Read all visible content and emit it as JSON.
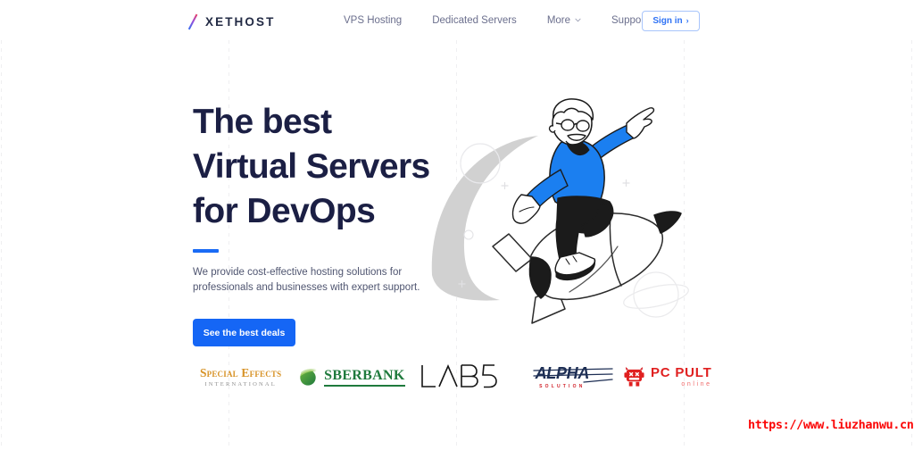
{
  "header": {
    "logo": {
      "mark": "slash-gradient",
      "text": "XETHOST"
    },
    "nav": [
      {
        "label": "VPS Hosting",
        "has_dropdown": false
      },
      {
        "label": "Dedicated Servers",
        "has_dropdown": false
      },
      {
        "label": "More",
        "has_dropdown": true
      },
      {
        "label": "Support",
        "has_dropdown": true
      }
    ],
    "signin": {
      "label": "Sign in",
      "arrow": "›"
    }
  },
  "hero": {
    "headline": "The best\nVirtual Servers\nfor DevOps",
    "subcopy": "We provide cost-effective hosting solutions for\nprofessionals and businesses with expert support.",
    "cta_label": "See the best deals",
    "illustration": "man-riding-rocket-pointing-up"
  },
  "partners": [
    {
      "name": "special-effects-international",
      "line1": "Special Effects",
      "line2": "INTERNATIONAL"
    },
    {
      "name": "sberbank",
      "line1": "SBERBANK"
    },
    {
      "name": "lab5",
      "line1": "LAB5"
    },
    {
      "name": "alpha-solution",
      "line1": "ALPHA",
      "line2": "SOLUTION"
    },
    {
      "name": "pc-pult-online",
      "line1": "PC PULT",
      "line2": "online"
    }
  ],
  "watermark": {
    "text": "https://www.liuzhanwu.cn"
  },
  "colors": {
    "accent_blue": "#1566f5",
    "headline_navy": "#1b1f44",
    "nav_gray": "#6b6f8d",
    "sber_green": "#1f7a3d",
    "sfx_gold": "#d79226",
    "alpha_navy": "#1d2e54",
    "pcp_red": "#e02020",
    "watermark_red": "#fb0606",
    "gridline": "#efeff1"
  },
  "grid": {
    "spacing_px": 255,
    "positions": [
      1,
      256,
      511,
      766,
      1021
    ]
  }
}
